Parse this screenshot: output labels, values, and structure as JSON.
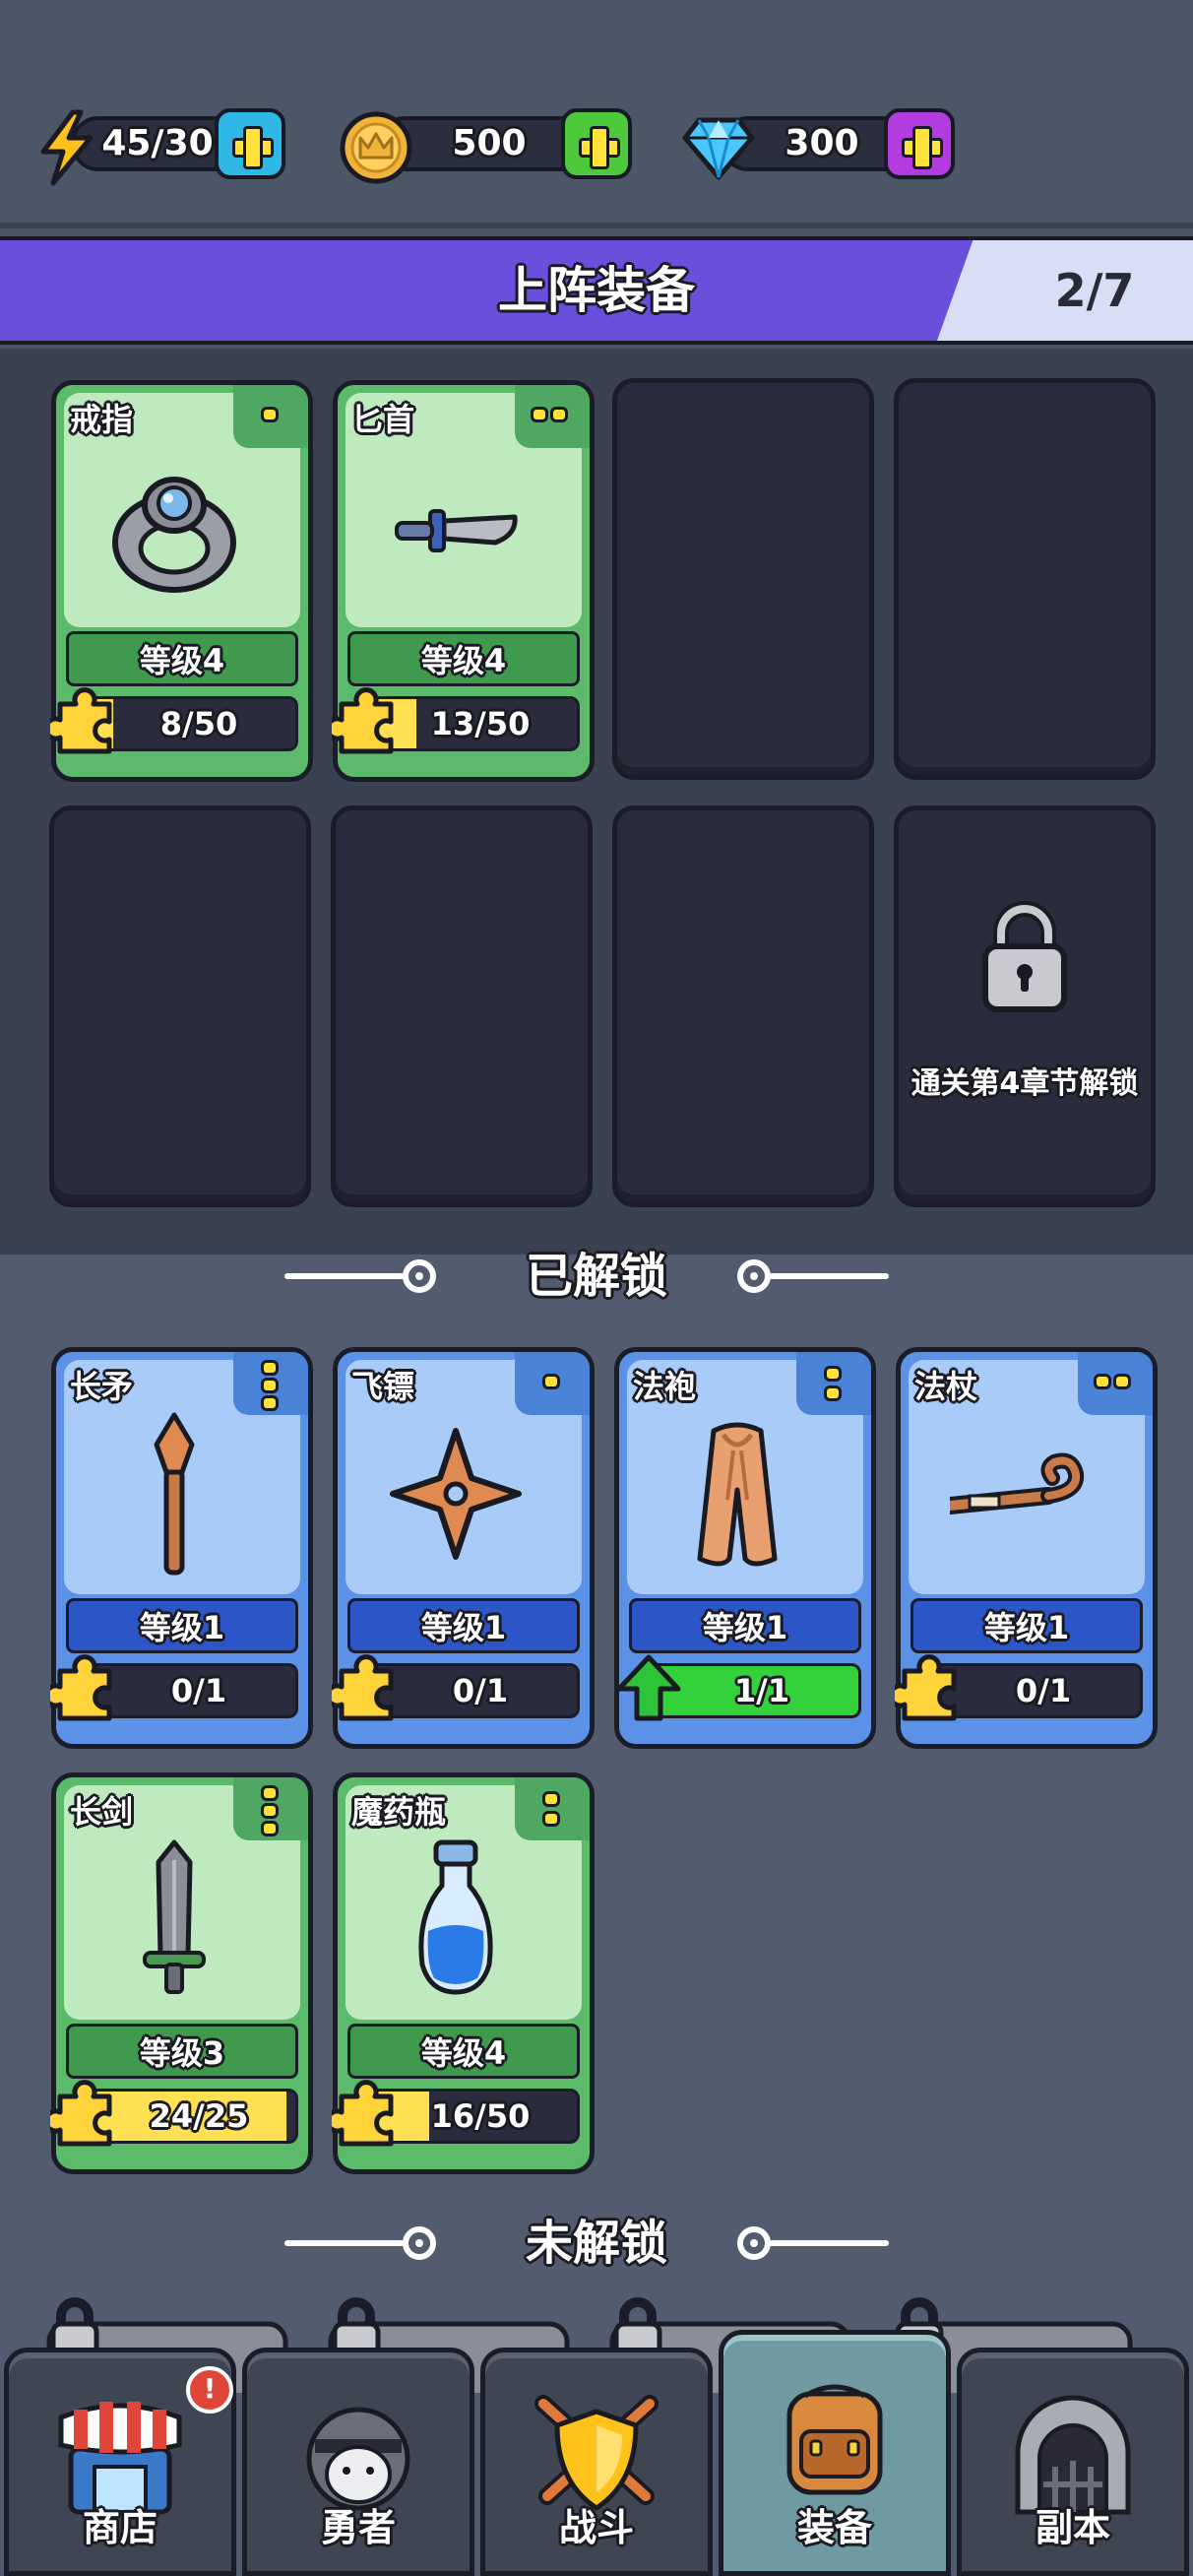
{
  "currencies": {
    "energy": {
      "value": "45/30",
      "icon": "lightning-icon",
      "plus_color": "#2fb8e6"
    },
    "gold": {
      "value": "500",
      "icon": "crown-coin-icon",
      "plus_color": "#4ec93c"
    },
    "gems": {
      "value": "300",
      "icon": "diamond-icon",
      "plus_color": "#b23ce0"
    }
  },
  "equipped": {
    "title": "上阵装备",
    "count": "2/7",
    "items": [
      {
        "name": "戒指",
        "level": "等级4",
        "progress": "8/50",
        "fill": 0.16,
        "icon": "ring-icon"
      },
      {
        "name": "匕首",
        "level": "等级4",
        "progress": "13/50",
        "fill": 0.26,
        "icon": "dagger-icon"
      }
    ],
    "locked_message": "通关第4章节解锁"
  },
  "unlocked": {
    "title": "已解锁",
    "items": [
      {
        "name": "长矛",
        "level": "等级1",
        "progress": "0/1",
        "fill": 0,
        "icon": "spear-icon"
      },
      {
        "name": "飞镖",
        "level": "等级1",
        "progress": "0/1",
        "fill": 0,
        "icon": "shuriken-icon"
      },
      {
        "name": "法袍",
        "level": "等级1",
        "progress": "1/1",
        "fill": 1,
        "icon": "robe-icon"
      },
      {
        "name": "法杖",
        "level": "等级1",
        "progress": "0/1",
        "fill": 0,
        "icon": "staff-icon"
      },
      {
        "name": "长剑",
        "level": "等级3",
        "progress": "24/25",
        "fill": 0.96,
        "icon": "sword-icon"
      },
      {
        "name": "魔药瓶",
        "level": "等级4",
        "progress": "16/50",
        "fill": 0.32,
        "icon": "potion-icon"
      }
    ]
  },
  "locked_section": {
    "title": "未解锁"
  },
  "nav": {
    "tabs": [
      {
        "label": "商店",
        "icon": "shop-icon",
        "badge": "!"
      },
      {
        "label": "勇者",
        "icon": "hero-icon"
      },
      {
        "label": "战斗",
        "icon": "battle-shield-icon"
      },
      {
        "label": "装备",
        "icon": "backpack-icon",
        "active": true
      },
      {
        "label": "副本",
        "icon": "dungeon-gate-icon"
      }
    ]
  }
}
